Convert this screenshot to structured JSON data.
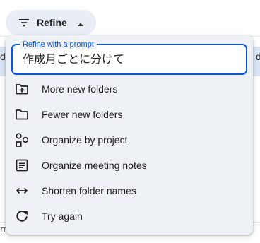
{
  "refine_chip": {
    "label": "Refine",
    "icon": "filter-icon",
    "state_icon": "caret-up-icon"
  },
  "prompt": {
    "label": "Refine with a prompt",
    "value": "作成月ごとに分けて"
  },
  "menu": {
    "items": [
      {
        "label": "More new folders",
        "icon": "create-new-folder-icon"
      },
      {
        "label": "Fewer new folders",
        "icon": "folder-icon"
      },
      {
        "label": "Organize by project",
        "icon": "project-shapes-icon"
      },
      {
        "label": "Organize meeting notes",
        "icon": "notes-document-icon"
      },
      {
        "label": "Shorten folder names",
        "icon": "arrows-horizontal-icon"
      },
      {
        "label": "Try again",
        "icon": "refresh-icon"
      }
    ]
  },
  "background": {
    "row_edge_left": "d",
    "row_edge_right": "d",
    "bottom_edge_left": "m"
  },
  "colors": {
    "accent": "#0b57d0",
    "panel_bg": "#eef1f5",
    "chip_bg": "#e9eef6",
    "selected_row": "#dbe5f6",
    "text": "#1f1f1f"
  }
}
